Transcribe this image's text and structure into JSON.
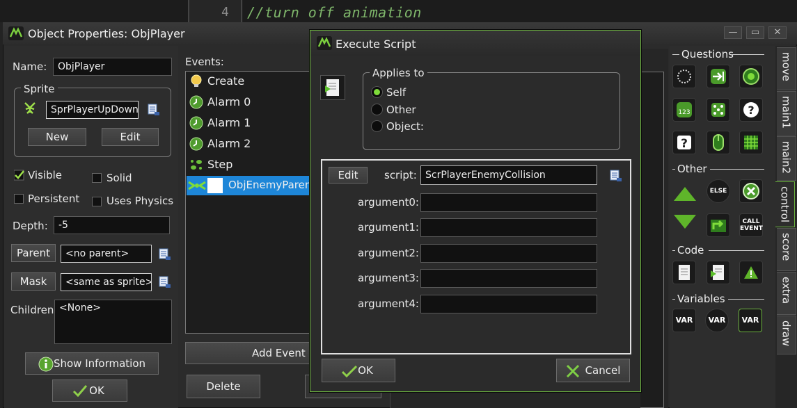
{
  "editor": {
    "line_number": "4",
    "code_line": "//turn off animation"
  },
  "window": {
    "title": "Object Properties: ObjPlayer"
  },
  "object": {
    "name_label": "Name:",
    "name_value": "ObjPlayer",
    "sprite_group": "Sprite",
    "sprite_value": "SprPlayerUpDown",
    "new_label": "New",
    "edit_label": "Edit",
    "visible_label": "Visible",
    "solid_label": "Solid",
    "persistent_label": "Persistent",
    "physics_label": "Uses Physics",
    "depth_label": "Depth:",
    "depth_value": "-5",
    "parent_label": "Parent",
    "parent_value": "<no parent>",
    "mask_label": "Mask",
    "mask_value": "<same as sprite>",
    "children_label": "Children:",
    "children_value": "<None>",
    "show_info_label": "Show Information",
    "ok_label": "OK"
  },
  "events": {
    "header": "Events:",
    "items": [
      {
        "label": "Create",
        "icon": "bulb-icon"
      },
      {
        "label": "Alarm 0",
        "icon": "alarm-icon"
      },
      {
        "label": "Alarm 1",
        "icon": "alarm-icon"
      },
      {
        "label": "Alarm 2",
        "icon": "alarm-icon"
      },
      {
        "label": "Step",
        "icon": "step-icon"
      },
      {
        "label": "ObjEnemyParen",
        "icon": "collision-icon"
      }
    ],
    "add_event_label": "Add Event",
    "delete_label": "Delete"
  },
  "dialog": {
    "title": "Execute Script",
    "applies_to_label": "Applies to",
    "options": [
      "Self",
      "Other",
      "Object:"
    ],
    "selected": "Self",
    "edit_label": "Edit",
    "script_label": "script:",
    "script_value": "ScrPlayerEnemyCollision",
    "arguments": [
      {
        "label": "argument0:",
        "value": ""
      },
      {
        "label": "argument1:",
        "value": ""
      },
      {
        "label": "argument2:",
        "value": ""
      },
      {
        "label": "argument3:",
        "value": ""
      },
      {
        "label": "argument4:",
        "value": ""
      }
    ],
    "ok_label": "OK",
    "cancel_label": "Cancel"
  },
  "palette": {
    "questions_header": "Questions",
    "other_header": "Other",
    "code_header": "Code",
    "variables_header": "Variables",
    "else_text": "ELSE",
    "call_text": "CALL",
    "event_text": "EVENT",
    "var_text": "VAR",
    "tabs": [
      "move",
      "main1",
      "main2",
      "control",
      "score",
      "extra",
      "draw"
    ],
    "active_tab": "control"
  },
  "colors": {
    "accent": "#6cb33f",
    "selection": "#1e86d8"
  }
}
